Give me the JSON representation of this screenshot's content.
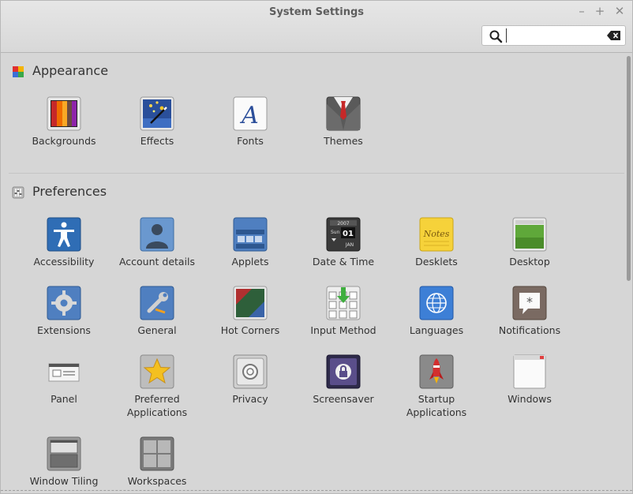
{
  "window": {
    "title": "System Settings"
  },
  "controls": {
    "minimize": "–",
    "maximize": "+",
    "close": "✕"
  },
  "search": {
    "value": "",
    "placeholder": "",
    "icon": "search-icon",
    "clear_icon": "clear-text-icon"
  },
  "sections": [
    {
      "title": "Appearance",
      "icon": "appearance-icon",
      "items": [
        {
          "label": "Backgrounds",
          "icon": "backgrounds-icon"
        },
        {
          "label": "Effects",
          "icon": "effects-icon"
        },
        {
          "label": "Fonts",
          "icon": "fonts-icon"
        },
        {
          "label": "Themes",
          "icon": "themes-icon"
        }
      ]
    },
    {
      "title": "Preferences",
      "icon": "preferences-icon",
      "items": [
        {
          "label": "Accessibility",
          "icon": "accessibility-icon"
        },
        {
          "label": "Account details",
          "icon": "account-details-icon"
        },
        {
          "label": "Applets",
          "icon": "applets-icon"
        },
        {
          "label": "Date & Time",
          "icon": "date-time-icon",
          "icon_text": [
            "2007",
            "Sun",
            "01",
            "JAN"
          ]
        },
        {
          "label": "Desklets",
          "icon": "desklets-icon",
          "icon_text": "Notes"
        },
        {
          "label": "Desktop",
          "icon": "desktop-icon"
        },
        {
          "label": "Extensions",
          "icon": "extensions-icon"
        },
        {
          "label": "General",
          "icon": "general-icon"
        },
        {
          "label": "Hot Corners",
          "icon": "hot-corners-icon"
        },
        {
          "label": "Input Method",
          "icon": "input-method-icon"
        },
        {
          "label": "Languages",
          "icon": "languages-icon"
        },
        {
          "label": "Notifications",
          "icon": "notifications-icon"
        },
        {
          "label": "Panel",
          "icon": "panel-icon"
        },
        {
          "label": "Preferred\nApplications",
          "icon": "preferred-applications-icon"
        },
        {
          "label": "Privacy",
          "icon": "privacy-icon"
        },
        {
          "label": "Screensaver",
          "icon": "screensaver-icon"
        },
        {
          "label": "Startup\nApplications",
          "icon": "startup-applications-icon"
        },
        {
          "label": "Windows",
          "icon": "windows-icon"
        },
        {
          "label": "Window Tiling",
          "icon": "window-tiling-icon"
        },
        {
          "label": "Workspaces",
          "icon": "workspaces-icon"
        }
      ]
    }
  ]
}
